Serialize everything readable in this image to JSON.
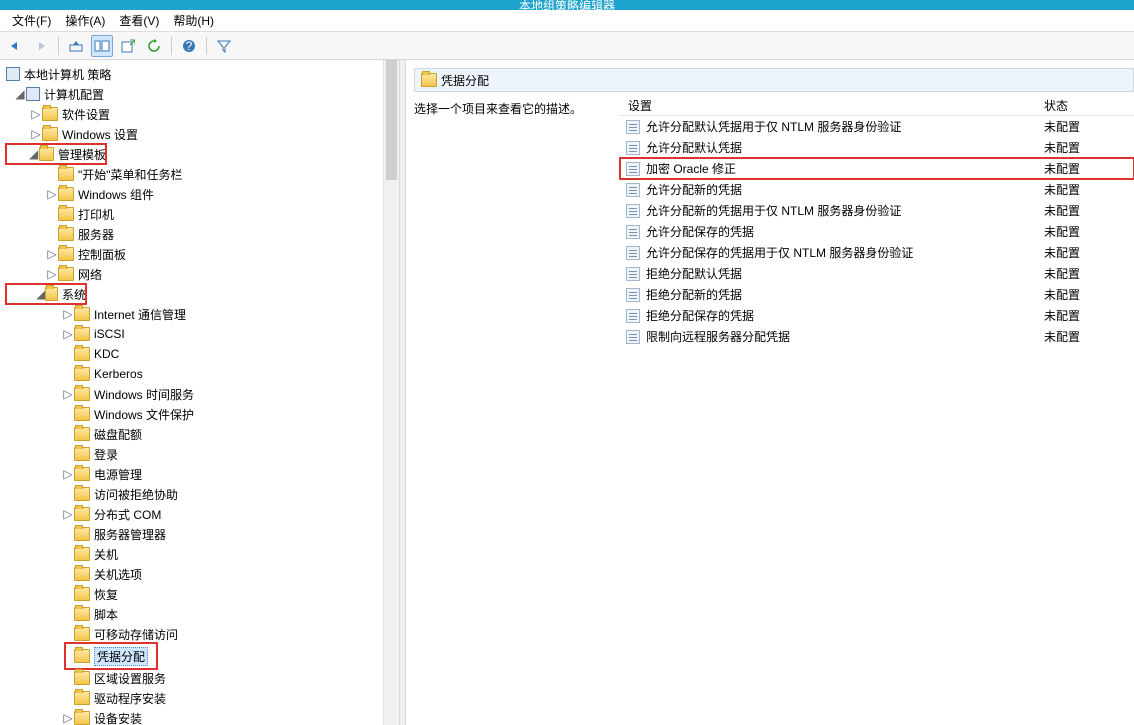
{
  "title": "本地组策略编辑器",
  "menubar": {
    "file": "文件(F)",
    "action": "操作(A)",
    "view": "查看(V)",
    "help": "帮助(H)"
  },
  "tree": {
    "root": "本地计算机 策略",
    "computer_config": "计算机配置",
    "software": "软件设置",
    "windows_settings": "Windows 设置",
    "admin_templates": "管理模板",
    "start_menu": "\"开始\"菜单和任务栏",
    "win_components": "Windows 组件",
    "printers": "打印机",
    "server": "服务器",
    "control_panel": "控制面板",
    "network": "网络",
    "system": "系统",
    "internet_comm": "Internet 通信管理",
    "iscsi": "iSCSI",
    "kdc": "KDC",
    "kerberos": "Kerberos",
    "win_time": "Windows 时间服务",
    "win_file_protect": "Windows 文件保护",
    "disk_quota": "磁盘配额",
    "logon": "登录",
    "power": "电源管理",
    "access_denied": "访问被拒绝协助",
    "dcom": "分布式 COM",
    "server_mgr": "服务器管理器",
    "shutdown": "关机",
    "shutdown_opt": "关机选项",
    "recovery": "恢复",
    "scripts": "脚本",
    "removable": "可移动存储访问",
    "cred_deleg": "凭据分配",
    "regional": "区域设置服务",
    "driver_install": "驱动程序安装",
    "device_install": "设备安装"
  },
  "right": {
    "header": "凭据分配",
    "hint": "选择一个项目来查看它的描述。",
    "col_setting": "设置",
    "col_state": "状态",
    "rows": [
      {
        "name": "允许分配默认凭据用于仅 NTLM 服务器身份验证",
        "state": "未配置"
      },
      {
        "name": "允许分配默认凭据",
        "state": "未配置"
      },
      {
        "name": "加密 Oracle 修正",
        "state": "未配置"
      },
      {
        "name": "允许分配新的凭据",
        "state": "未配置"
      },
      {
        "name": "允许分配新的凭据用于仅 NTLM 服务器身份验证",
        "state": "未配置"
      },
      {
        "name": "允许分配保存的凭据",
        "state": "未配置"
      },
      {
        "name": "允许分配保存的凭据用于仅 NTLM 服务器身份验证",
        "state": "未配置"
      },
      {
        "name": "拒绝分配默认凭据",
        "state": "未配置"
      },
      {
        "name": "拒绝分配新的凭据",
        "state": "未配置"
      },
      {
        "name": "拒绝分配保存的凭据",
        "state": "未配置"
      },
      {
        "name": "限制向远程服务器分配凭据",
        "state": "未配置"
      }
    ]
  }
}
